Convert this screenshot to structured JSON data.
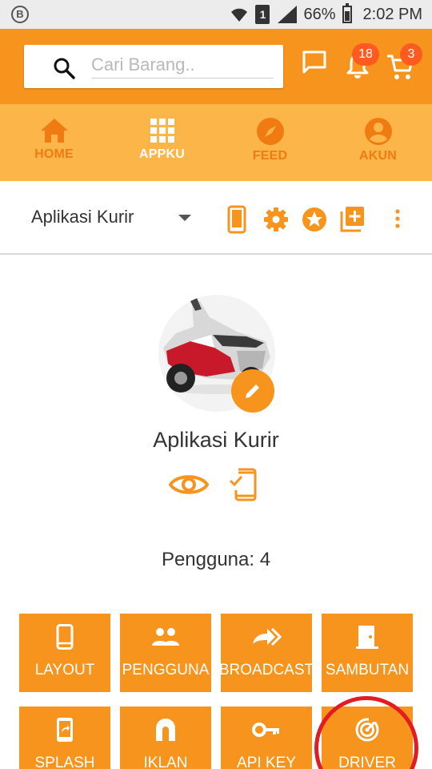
{
  "status_bar": {
    "left_icon": "B",
    "sim": "1",
    "battery": "66%",
    "time": "2:02 PM"
  },
  "header": {
    "search_placeholder": "Cari Barang..",
    "notifications_count": "18",
    "cart_count": "3"
  },
  "nav": [
    {
      "label": "HOME",
      "icon": "home-icon"
    },
    {
      "label": "APPKU",
      "icon": "grid-apps-icon"
    },
    {
      "label": "FEED",
      "icon": "compass-icon"
    },
    {
      "label": "AKUN",
      "icon": "account-icon"
    }
  ],
  "app_bar": {
    "selected_app": "Aplikasi Kurir",
    "tools": [
      "phone-preview-icon",
      "settings-gear-icon",
      "star-icon",
      "add-library-icon",
      "more-vert-icon"
    ]
  },
  "profile": {
    "title": "Aplikasi Kurir",
    "users_text": "Pengguna: 4"
  },
  "tiles": [
    {
      "label": "LAYOUT",
      "icon": "phone-icon"
    },
    {
      "label": "PENGGUNA",
      "icon": "people-icon"
    },
    {
      "label": "BROADCAST",
      "icon": "forward-arrows-icon"
    },
    {
      "label": "SAMBUTAN",
      "icon": "door-icon"
    },
    {
      "label": "SPLASH",
      "icon": "phone-forward-icon"
    },
    {
      "label": "IKLAN",
      "icon": "ad-icon"
    },
    {
      "label": "API KEY",
      "icon": "key-icon"
    },
    {
      "label": "DRIVER",
      "icon": "radar-icon"
    }
  ],
  "colors": {
    "primary": "#f7941d",
    "nav_bg": "#fbb548",
    "badge": "#ff5a1f",
    "highlight": "#e31b23"
  }
}
